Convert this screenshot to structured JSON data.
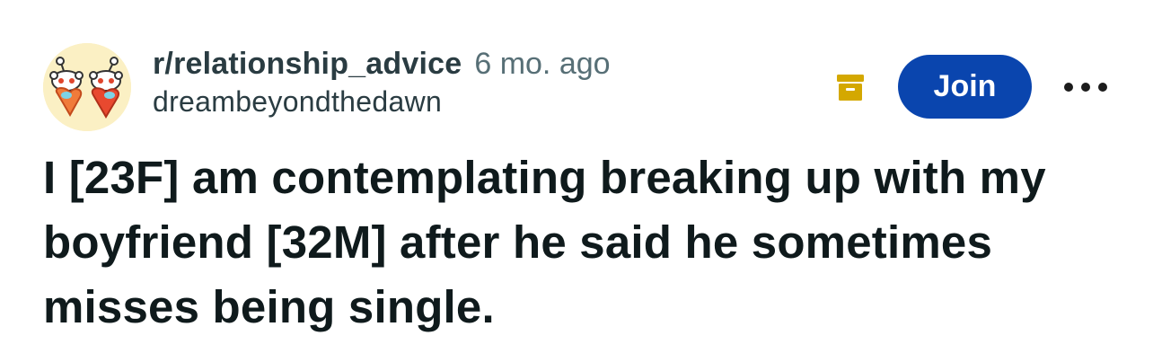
{
  "post": {
    "subreddit": "r/relationship_advice",
    "time_ago": "6 mo. ago",
    "username": "dreambeyondthedawn",
    "join_label": "Join",
    "title": "I [23F] am contemplating breaking up with my boyfriend [32M] after he said he sometimes misses being single."
  },
  "icons": {
    "avatar": "subreddit-avatar-snoo-hearts",
    "archive": "archive-box-icon",
    "more": "more-options-icon"
  },
  "colors": {
    "join_bg": "#0a45ae",
    "archive": "#d4a800",
    "subreddit_text": "#2a3c42",
    "time_text": "#576f76",
    "title_text": "#0f1a1c",
    "avatar_bg": "#fbf0c4"
  }
}
